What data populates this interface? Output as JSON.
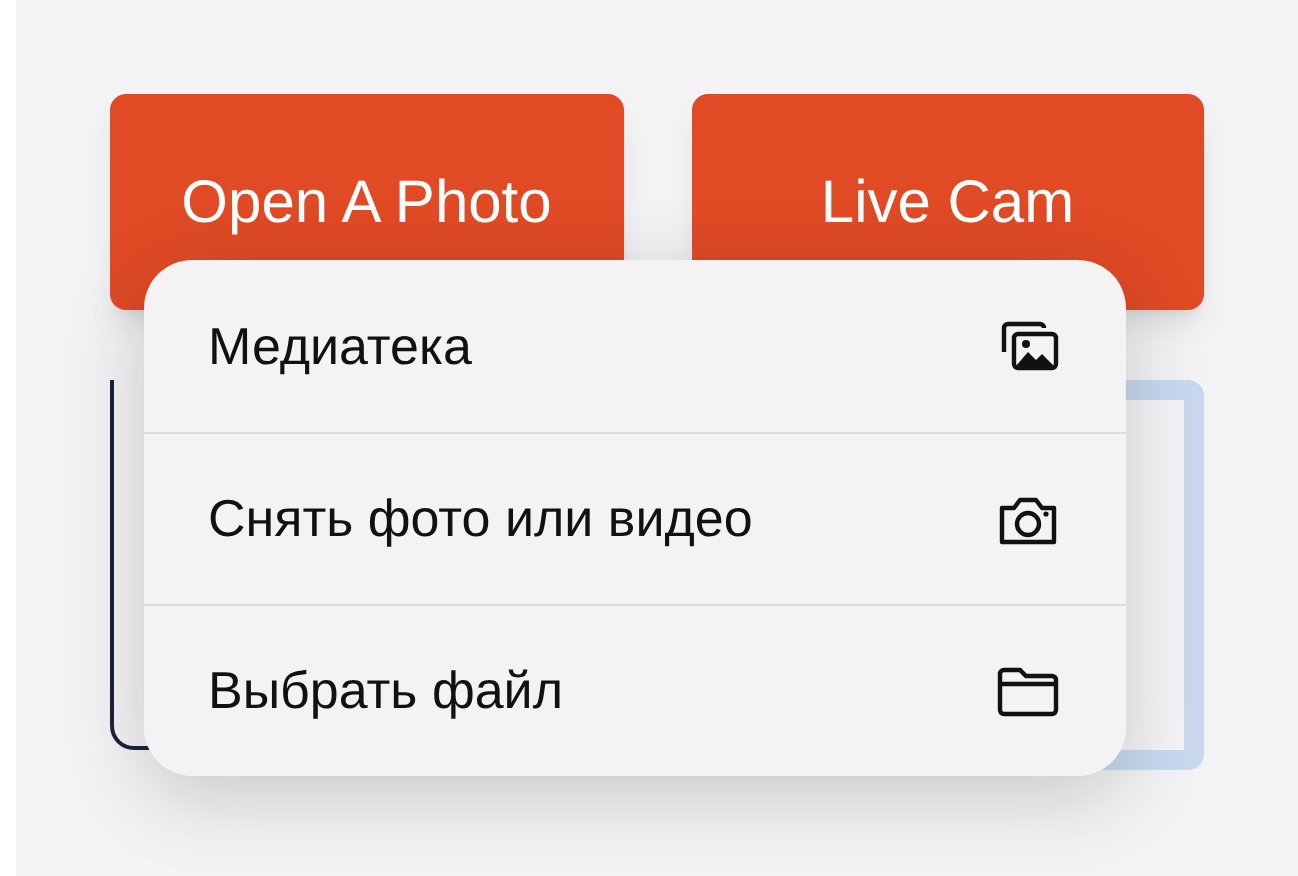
{
  "buttons": [
    {
      "label": "Open A Photo"
    },
    {
      "label": "Live Cam"
    }
  ],
  "menu": {
    "items": [
      {
        "label": "Медиатека",
        "kind": "library"
      },
      {
        "label": "Снять фото или видео",
        "kind": "camera"
      },
      {
        "label": "Выбрать файл",
        "kind": "folder"
      }
    ]
  }
}
